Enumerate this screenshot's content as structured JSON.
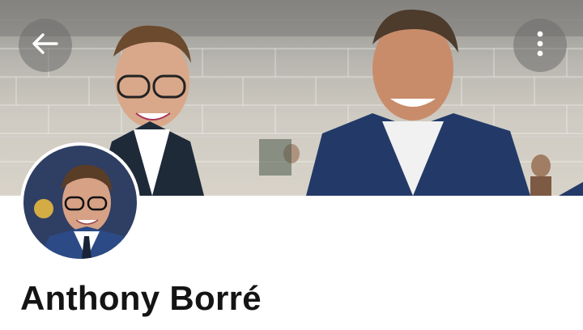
{
  "profile": {
    "name": "Anthony Borré"
  },
  "banner": {
    "description_icon": "photo-banner"
  },
  "icons": {
    "back": "arrow-left-icon",
    "more": "more-vertical-icon"
  },
  "colors": {
    "button_overlay": "#6e6e6e",
    "name_text": "#141414",
    "background": "#ffffff"
  }
}
